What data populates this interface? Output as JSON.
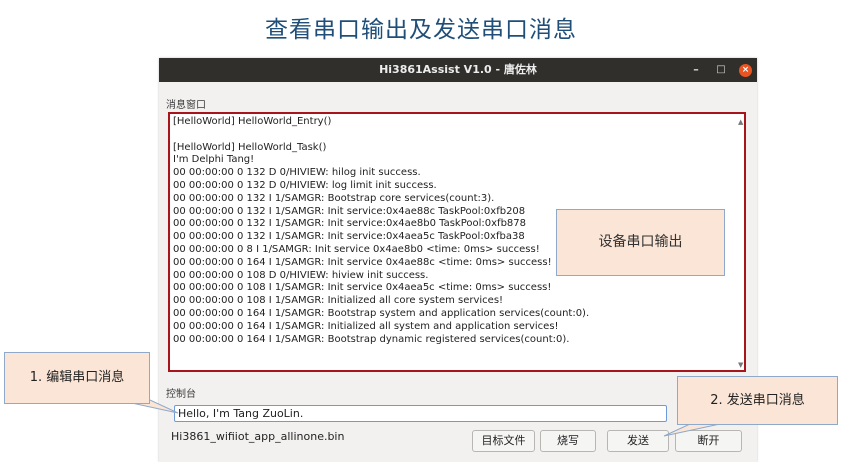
{
  "slide": {
    "title": "查看串口输出及发送串口消息"
  },
  "window": {
    "title": "Hi3861Assist V1.0 - 唐佐林",
    "minimize_glyph": "–",
    "maximize_glyph": "□",
    "close_glyph": "×"
  },
  "message_window": {
    "label": "消息窗口",
    "lines": [
      "[HelloWorld] HelloWorld_Entry()",
      "",
      "[HelloWorld] HelloWorld_Task()",
      "I'm Delphi Tang!",
      "00 00:00:00 0 132 D 0/HIVIEW: hilog init success.",
      "00 00:00:00 0 132 D 0/HIVIEW: log limit init success.",
      "00 00:00:00 0 132 I 1/SAMGR: Bootstrap core services(count:3).",
      "00 00:00:00 0 132 I 1/SAMGR: Init service:0x4ae88c TaskPool:0xfb208",
      "00 00:00:00 0 132 I 1/SAMGR: Init service:0x4ae8b0 TaskPool:0xfb878",
      "00 00:00:00 0 132 I 1/SAMGR: Init service:0x4aea5c TaskPool:0xfba38",
      "00 00:00:00 0 8 I 1/SAMGR: Init service 0x4ae8b0 <time: 0ms> success!",
      "00 00:00:00 0 164 I 1/SAMGR: Init service 0x4ae88c <time: 0ms> success!",
      "00 00:00:00 0 108 D 0/HIVIEW: hiview init success.",
      "00 00:00:00 0 108 I 1/SAMGR: Init service 0x4aea5c <time: 0ms> success!",
      "00 00:00:00 0 108 I 1/SAMGR: Initialized all core system services!",
      "00 00:00:00 0 164 I 1/SAMGR: Bootstrap system and application services(count:0).",
      "00 00:00:00 0 164 I 1/SAMGR: Initialized all system and application services!",
      "00 00:00:00 0 164 I 1/SAMGR: Bootstrap dynamic registered services(count:0)."
    ],
    "overlay_label": "设备串口输出"
  },
  "console": {
    "label": "控制台",
    "input_value": "Hello, I'm Tang ZuoLin.",
    "file_name": "Hi3861_wifiiot_app_allinone.bin",
    "buttons": {
      "target_file": "目标文件",
      "burn": "烧写",
      "send": "发送",
      "disconnect": "断开"
    }
  },
  "callouts": {
    "edit": "1. 编辑串口消息",
    "send": "2. 发送串口消息"
  },
  "colors": {
    "title": "#1f4e79",
    "highlight_border": "#a8141b",
    "callout_fill": "#fbe5d6",
    "close_button": "#e95420"
  }
}
